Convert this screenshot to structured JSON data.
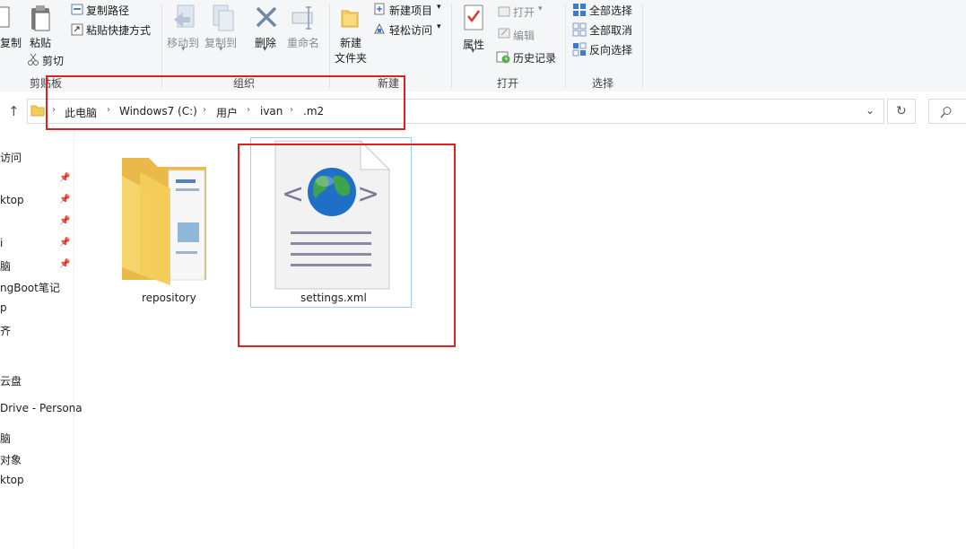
{
  "ribbon": {
    "clipboard": {
      "copy_cut": "复制",
      "paste": "粘贴",
      "copy_path": "复制路径",
      "paste_shortcut": "粘贴快捷方式",
      "cut": "剪切",
      "group_label": "剪贴板"
    },
    "organize": {
      "move_to": "移动到",
      "copy_to": "复制到",
      "delete": "删除",
      "rename": "重命名",
      "group_label": "组织"
    },
    "new": {
      "new_folder_line1": "新建",
      "new_folder_line2": "文件夹",
      "new_item": "新建项目",
      "easy_access": "轻松访问",
      "group_label": "新建"
    },
    "open": {
      "properties": "属性",
      "open": "打开",
      "edit": "编辑",
      "history": "历史记录",
      "group_label": "打开"
    },
    "select": {
      "select_all": "全部选择",
      "select_none": "全部取消",
      "invert": "反向选择",
      "group_label": "选择"
    }
  },
  "address": {
    "crumbs": [
      "此电脑",
      "Windows7 (C:)",
      "用户",
      "ivan",
      ".m2"
    ]
  },
  "nav": {
    "items": [
      "访问",
      "ktop",
      "",
      "i",
      "脑",
      "ngBoot笔记",
      "p",
      "齐",
      "",
      "云盘",
      "Drive - Persona",
      "脑",
      "对象",
      "ktop",
      ""
    ]
  },
  "files": [
    {
      "name": "repository",
      "type": "folder"
    },
    {
      "name": "settings.xml",
      "type": "xml-file"
    }
  ],
  "colors": {
    "highlight_box": "#e02020",
    "folder": "#f3cd5a",
    "selection_border": "#99d1ff"
  }
}
